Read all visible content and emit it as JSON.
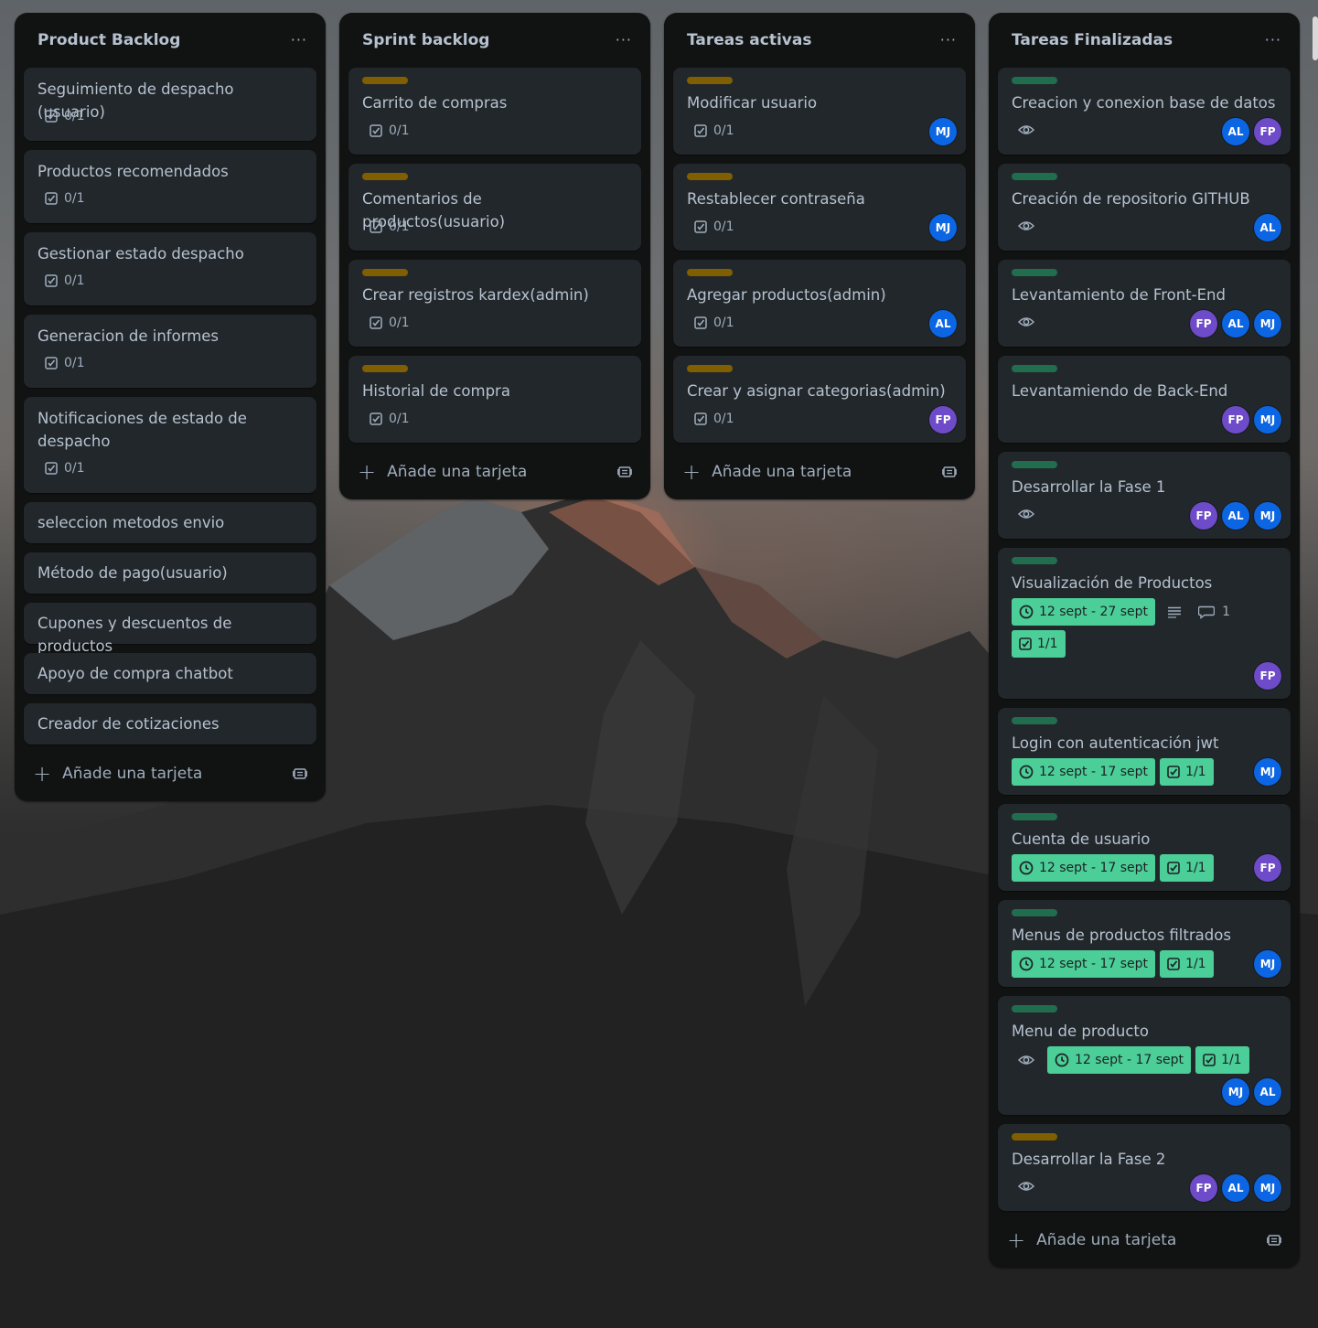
{
  "colors": {
    "list_bg": "#111212",
    "card_bg": "#22272b",
    "text": "#b6c2cf",
    "label_yellow": "#7f5f01",
    "label_green": "#216e4e",
    "badge_green": "#4bce97",
    "avatar_blue": "#0c66e4",
    "avatar_purple": "#6e4bc9"
  },
  "icons": {
    "menu": "ellipsis-icon",
    "checklist": "checklist-icon",
    "clock": "clock-icon",
    "watch": "eye-icon",
    "description": "description-icon",
    "comment": "comment-icon",
    "add": "plus-icon",
    "template": "template-icon"
  },
  "lists": [
    {
      "title": "Product Backlog",
      "menu": "···",
      "add_card": "Añade una tarjeta",
      "cards": [
        {
          "title": "Seguimiento de despacho (usuario)",
          "checklist": "0/1"
        },
        {
          "title": "Productos recomendados",
          "checklist": "0/1"
        },
        {
          "title": "Gestionar estado despacho",
          "checklist": "0/1"
        },
        {
          "title": "Generacion de informes",
          "checklist": "0/1"
        },
        {
          "title": "Notificaciones de estado de despacho",
          "checklist": "0/1"
        },
        {
          "title": "seleccion metodos envio"
        },
        {
          "title": "Método de pago(usuario)"
        },
        {
          "title": "Cupones y descuentos de productos"
        },
        {
          "title": "Apoyo de compra chatbot"
        },
        {
          "title": "Creador de cotizaciones"
        }
      ]
    },
    {
      "title": "Sprint backlog",
      "menu": "···",
      "add_card": "Añade una tarjeta",
      "cards": [
        {
          "title": "Carrito de compras",
          "checklist": "0/1",
          "label": "yellow"
        },
        {
          "title": "Comentarios de productos(usuario)",
          "checklist": "0/1",
          "label": "yellow"
        },
        {
          "title": "Crear registros kardex(admin)",
          "checklist": "0/1",
          "label": "yellow"
        },
        {
          "title": "Historial de compra",
          "checklist": "0/1",
          "label": "yellow"
        }
      ]
    },
    {
      "title": "Tareas activas",
      "menu": "···",
      "add_card": "Añade una tarjeta",
      "cards": [
        {
          "title": "Modificar usuario",
          "checklist": "0/1",
          "label": "yellow",
          "members": [
            "MJ"
          ]
        },
        {
          "title": "Restablecer contraseña",
          "checklist": "0/1",
          "label": "yellow",
          "members": [
            "MJ"
          ]
        },
        {
          "title": "Agregar productos(admin)",
          "checklist": "0/1",
          "label": "yellow",
          "members": [
            "AL"
          ]
        },
        {
          "title": "Crear y asignar categorias(admin)",
          "checklist": "0/1",
          "label": "yellow",
          "members": [
            "FP"
          ]
        }
      ]
    },
    {
      "title": "Tareas Finalizadas",
      "menu": "···",
      "add_card": "Añade una tarjeta",
      "cards": [
        {
          "title": "Creacion y conexion base de datos",
          "label": "green",
          "members": [
            "AL",
            "FP"
          ]
        },
        {
          "title": "Creación de repositorio GITHUB",
          "label": "green",
          "members": [
            "AL"
          ]
        },
        {
          "title": "Levantamiento de Front-End",
          "label": "green",
          "members": [
            "FP",
            "AL",
            "MJ"
          ]
        },
        {
          "title": "Levantamiendo de Back-End",
          "label": "green",
          "members": [
            "FP",
            "MJ"
          ]
        },
        {
          "title": "Desarrollar la Fase 1",
          "label": "green",
          "members": [
            "FP",
            "AL",
            "MJ"
          ]
        },
        {
          "title": "Visualización de Productos",
          "label": "green",
          "dates": "12 sept - 27 sept",
          "comments": "1",
          "checklist": "1/1",
          "members": [
            "FP"
          ]
        },
        {
          "title": "Login con autenticación jwt",
          "label": "green",
          "dates": "12 sept - 17 sept",
          "checklist": "1/1",
          "members": [
            "MJ"
          ]
        },
        {
          "title": "Cuenta de usuario",
          "label": "green",
          "dates": "12 sept - 17 sept",
          "checklist": "1/1",
          "members": [
            "FP"
          ]
        },
        {
          "title": "Menus de productos filtrados",
          "label": "green",
          "dates": "12 sept - 17 sept",
          "checklist": "1/1",
          "members": [
            "MJ"
          ]
        },
        {
          "title": "Menu de producto",
          "label": "green",
          "dates": "12 sept - 17 sept",
          "checklist": "1/1",
          "members": [
            "MJ",
            "AL"
          ]
        },
        {
          "title": "Desarrollar la Fase 2",
          "label": "yellow",
          "members": [
            "FP",
            "AL",
            "MJ"
          ]
        }
      ]
    }
  ]
}
